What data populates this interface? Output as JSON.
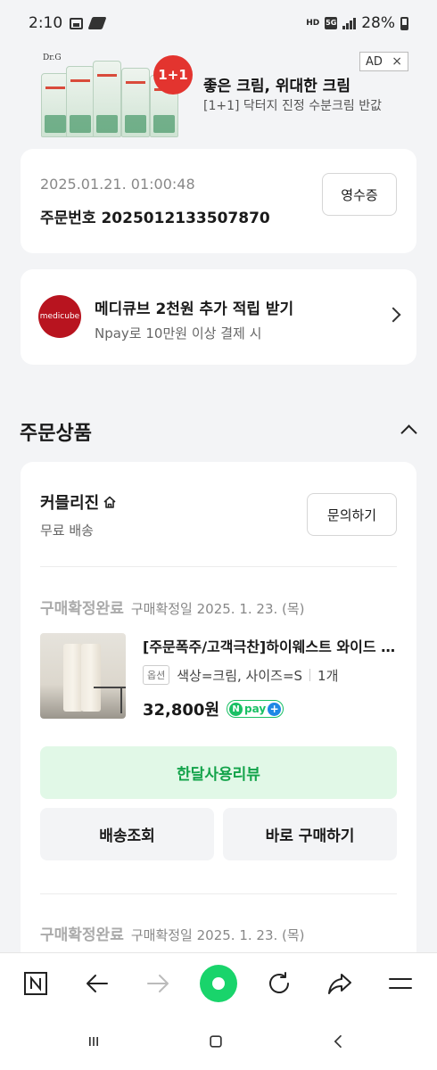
{
  "status_bar": {
    "time": "2:10",
    "hd_label": "HD",
    "network_label": "5G",
    "battery": "28%"
  },
  "ad": {
    "brand": "Dr.G",
    "badge": "1+1",
    "title": "좋은 크림, 위대한 크림",
    "subtitle": "[1+1] 닥터지 진정 수분크림 반값",
    "tag": "AD",
    "close": "×"
  },
  "order": {
    "datetime": "2025.01.21. 01:00:48",
    "number_label": "주문번호 2025012133507870",
    "receipt_button": "영수증"
  },
  "promo": {
    "logo_text": "medicube",
    "title": "메디큐브 2천원 추가 적립 받기",
    "subtitle": "Npay로 10만원 이상 결제 시"
  },
  "section": {
    "title": "주문상품"
  },
  "seller": {
    "name": "커믈리진",
    "shipping": "무료 배송",
    "inquiry_button": "문의하기"
  },
  "items": [
    {
      "status": "구매확정완료",
      "status_date": "구매확정일 2025. 1. 23. (목)",
      "name": "[주문폭주/고객극찬]하이웨스트 와이드 슬랙스",
      "option_badge": "옵션",
      "option": "색상=크림, 사이즈=S",
      "quantity": "1개",
      "price": "32,800원",
      "npay_n": "N",
      "npay_text": "pay",
      "npay_plus": "+",
      "review_button": "한달사용리뷰",
      "tracking_button": "배송조회",
      "buy_again_button": "바로 구매하기"
    },
    {
      "status": "구매확정완료",
      "status_date": "구매확정일 2025. 1. 23. (목)"
    }
  ],
  "colors": {
    "accent_green": "#19c064",
    "review_bg": "#e1f8e7",
    "background": "#f3f4f6",
    "medicube_red": "#b8141f"
  }
}
